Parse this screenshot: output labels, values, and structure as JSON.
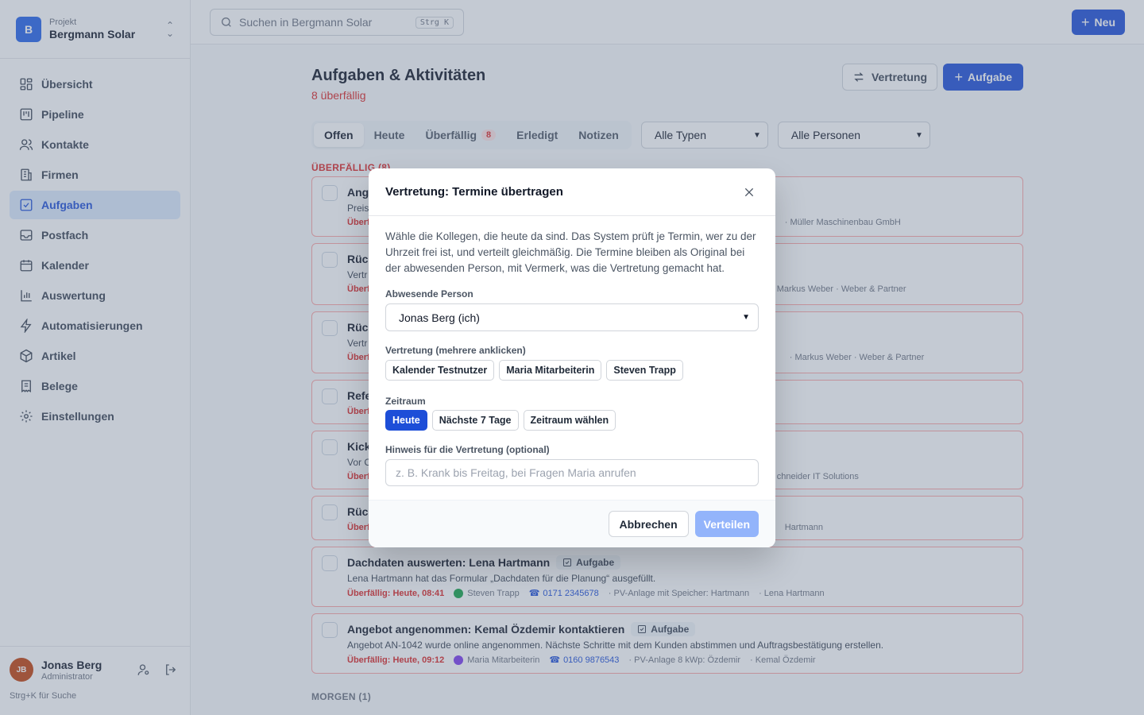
{
  "sidebar": {
    "project": {
      "logo": "B",
      "label": "Projekt",
      "name": "Bergmann Solar"
    },
    "items": [
      {
        "label": "Übersicht",
        "icon": "grid-icon"
      },
      {
        "label": "Pipeline",
        "icon": "kanban-icon"
      },
      {
        "label": "Kontakte",
        "icon": "users-icon"
      },
      {
        "label": "Firmen",
        "icon": "building-icon"
      },
      {
        "label": "Aufgaben",
        "icon": "checkbox-icon",
        "active": true
      },
      {
        "label": "Postfach",
        "icon": "inbox-icon"
      },
      {
        "label": "Kalender",
        "icon": "calendar-icon"
      },
      {
        "label": "Auswertung",
        "icon": "bar-chart-icon"
      },
      {
        "label": "Automatisierungen",
        "icon": "lightning-icon"
      },
      {
        "label": "Artikel",
        "icon": "box-icon"
      },
      {
        "label": "Belege",
        "icon": "receipt-icon"
      },
      {
        "label": "Einstellungen",
        "icon": "gear-icon"
      }
    ],
    "user": {
      "initials": "JB",
      "name": "Jonas Berg",
      "role": "Administrator"
    },
    "shortcut_hint": "Strg+K für Suche"
  },
  "topbar": {
    "search_placeholder": "Suchen in Bergmann Solar",
    "search_shortcut": "Strg K",
    "new_label": "Neu"
  },
  "page": {
    "title": "Aufgaben & Aktivitäten",
    "overdue_note": "8 überfällig",
    "vertretung_label": "Vertretung",
    "aufgabe_label": "Aufgabe",
    "tabs": [
      {
        "label": "Offen",
        "active": true
      },
      {
        "label": "Heute"
      },
      {
        "label": "Überfällig",
        "badge": "8"
      },
      {
        "label": "Erledigt"
      },
      {
        "label": "Notizen"
      }
    ],
    "type_filter": "Alle Typen",
    "person_filter": "Alle Personen",
    "section_overdue": "ÜBERFÄLLIG (8)",
    "section_tomorrow": "MORGEN (1)"
  },
  "tasks": [
    {
      "title": "Ang",
      "desc": "Preis",
      "due": "Überf",
      "meta_right": "· Müller Maschinenbau GmbH"
    },
    {
      "title": "Rück",
      "desc": "Vertr",
      "due": "Überf",
      "meta_right": "Markus Weber  · Weber & Partner"
    },
    {
      "title": "Rück",
      "desc": "Vertr",
      "due": "Überf",
      "meta_right": "· Markus Weber  · Weber & Partner"
    },
    {
      "title": "Refe",
      "desc": "",
      "due": "Überf",
      "meta_right": ""
    },
    {
      "title": "Kick",
      "desc": "Vor C",
      "due": "Überf",
      "meta_right": "chneider IT Solutions"
    },
    {
      "title": "Rück",
      "desc": "",
      "due": "Überf",
      "meta_right": "Hartmann"
    },
    {
      "title": "Dachdaten auswerten: Lena Hartmann",
      "type": "Aufgabe",
      "desc": "Lena Hartmann hat das Formular „Dachdaten für die Planung“ ausgefüllt.",
      "due": "Überfällig: Heute, 08:41",
      "assignee_initials": "ST",
      "assignee": "Steven Trapp",
      "assignee_color": "#16a34a",
      "phone": "0171 2345678",
      "deal": "· PV-Anlage mit Speicher: Hartmann",
      "contact": "· Lena Hartmann"
    },
    {
      "title": "Angebot angenommen: Kemal Özdemir kontaktieren",
      "type": "Aufgabe",
      "desc": "Angebot AN-1042 wurde online angenommen. Nächste Schritte mit dem Kunden abstimmen und Auftragsbestätigung erstellen.",
      "due": "Überfällig: Heute, 09:12",
      "assignee_initials": "MM",
      "assignee": "Maria Mitarbeiterin",
      "assignee_color": "#7c3aed",
      "phone": "0160 9876543",
      "deal": "· PV-Anlage 8 kWp: Özdemir",
      "contact": "· Kemal Özdemir"
    }
  ],
  "modal": {
    "title": "Vertretung: Termine übertragen",
    "description": "Wähle die Kollegen, die heute da sind. Das System prüft je Termin, wer zu der Uhrzeit frei ist, und verteilt gleichmäßig. Die Termine bleiben als Original bei der abwesenden Person, mit Vermerk, was die Vertretung gemacht hat.",
    "absent_label": "Abwesende Person",
    "absent_value": "Jonas Berg (ich)",
    "substitute_label": "Vertretung (mehrere anklicken)",
    "substitutes": [
      "Kalender Testnutzer",
      "Maria Mitarbeiterin",
      "Steven Trapp"
    ],
    "period_label": "Zeitraum",
    "periods": [
      {
        "label": "Heute",
        "active": true
      },
      {
        "label": "Nächste 7 Tage"
      },
      {
        "label": "Zeitraum wählen"
      }
    ],
    "note_label": "Hinweis für die Vertretung (optional)",
    "note_placeholder": "z. B. Krank bis Freitag, bei Fragen Maria anrufen",
    "cancel_label": "Abbrechen",
    "submit_label": "Verteilen"
  }
}
